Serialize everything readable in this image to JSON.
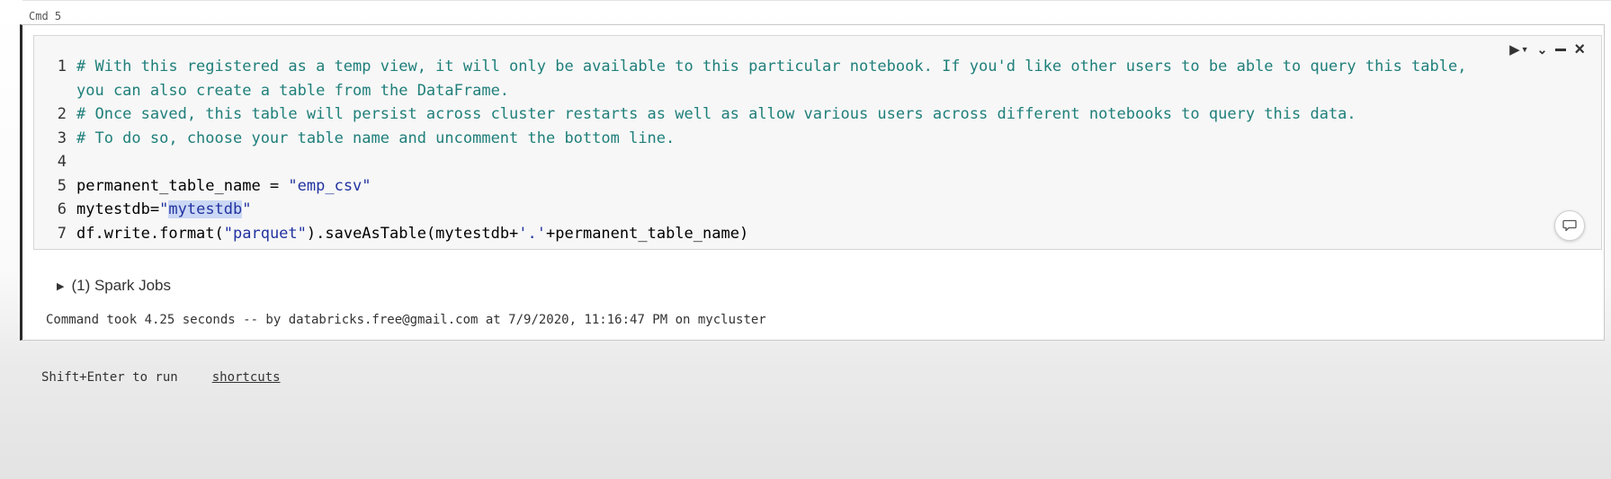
{
  "cell": {
    "label": "Cmd 5",
    "code_lines": [
      {
        "number": "1",
        "text": "# With this registered as a temp view, it will only be available to this particular notebook. If you'd like other users to be able to query this table,"
      },
      {
        "number": "",
        "text": "you can also create a table from the DataFrame."
      },
      {
        "number": "2",
        "text": "# Once saved, this table will persist across cluster restarts as well as allow various users across different notebooks to query this data."
      },
      {
        "number": "3",
        "text": "# To do so, choose your table name and uncomment the bottom line."
      },
      {
        "number": "4",
        "text": ""
      },
      {
        "number": "5",
        "code_name": "permanent_table_name = ",
        "code_value": "\"emp_csv\""
      },
      {
        "number": "6",
        "code_name": "mytestdb=",
        "code_q1": "\"",
        "code_selected": "mytestdb",
        "code_q2": "\""
      },
      {
        "number": "7",
        "code_a": "df.write.format(",
        "code_str": "\"parquet\"",
        "code_b": ").saveAsTable(mytestdb+",
        "code_str2": "'.'",
        "code_c": "+permanent_table_name)"
      }
    ],
    "toolbar_icons": [
      "run-icon",
      "dropdown-caret-icon",
      "chevron-down-icon",
      "minimize-icon",
      "close-icon"
    ],
    "spark_jobs": "(1) Spark Jobs",
    "status": "Command took 4.25 seconds -- by databricks.free@gmail.com at 7/9/2020, 11:16:47 PM on mycluster"
  },
  "footer": {
    "hint": "Shift+Enter to run",
    "shortcuts": "shortcuts"
  },
  "colors": {
    "comment": "#1f7f7a",
    "string": "#2233a0",
    "selection": "#cbd8f5"
  }
}
